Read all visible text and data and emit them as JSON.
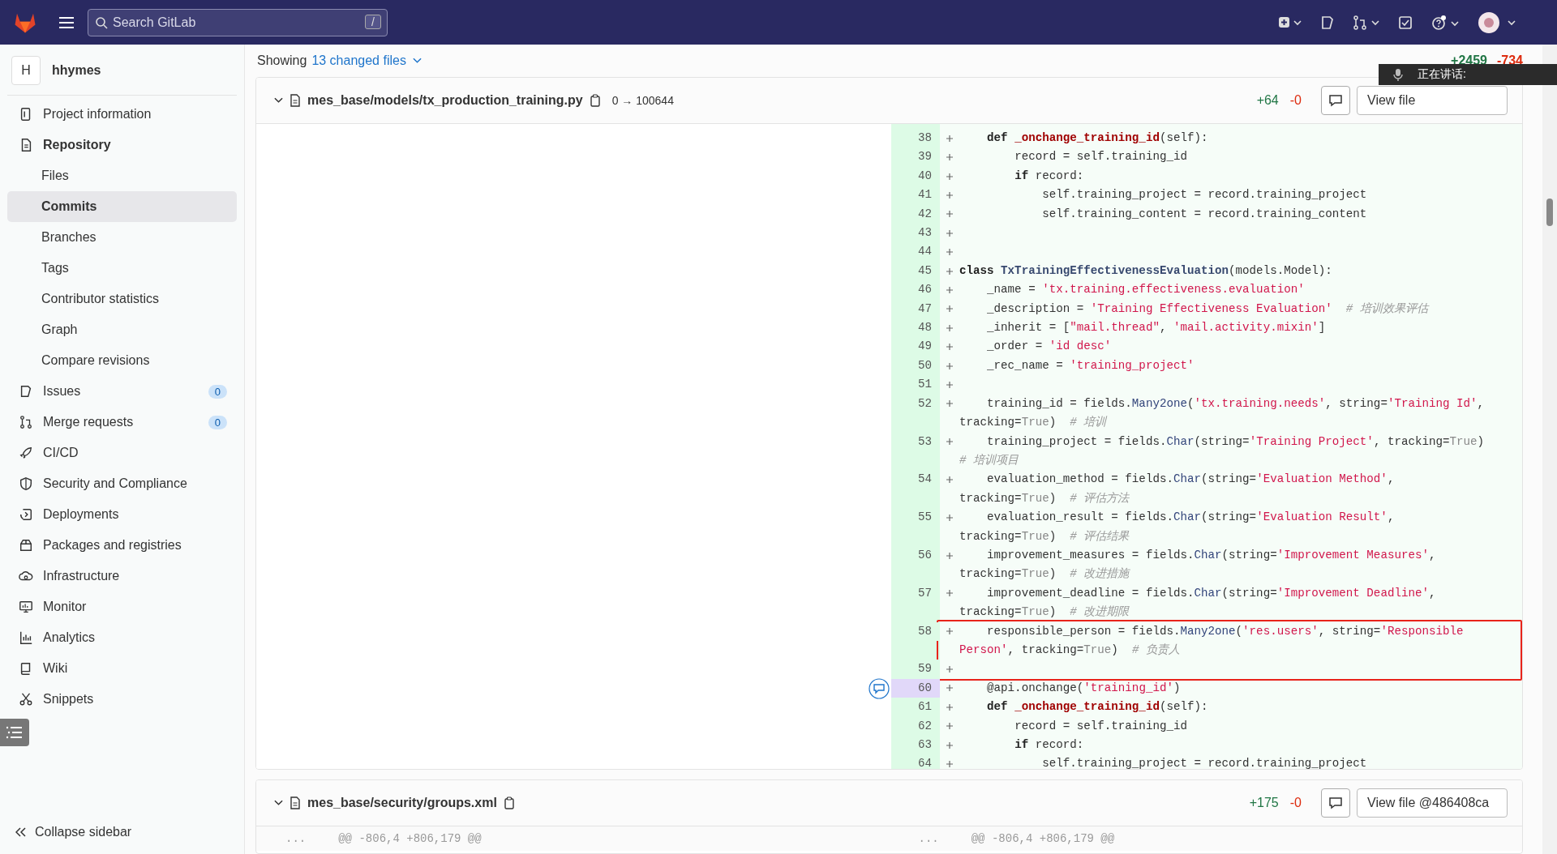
{
  "top_bar": {
    "search": {
      "placeholder": "Search GitLab",
      "shortcut": "/"
    }
  },
  "sidebar": {
    "project": {
      "avatar": "H",
      "name": "hhymes"
    },
    "items": [
      {
        "label": "Project information",
        "expanded": false
      },
      {
        "label": "Repository",
        "expanded": true,
        "children": [
          {
            "label": "Files",
            "selected": false
          },
          {
            "label": "Commits",
            "selected": true
          },
          {
            "label": "Branches",
            "selected": false
          },
          {
            "label": "Tags",
            "selected": false
          },
          {
            "label": "Contributor statistics",
            "selected": false
          },
          {
            "label": "Graph",
            "selected": false
          },
          {
            "label": "Compare revisions",
            "selected": false
          }
        ]
      },
      {
        "label": "Issues",
        "expanded": false,
        "badge": "0"
      },
      {
        "label": "Merge requests",
        "expanded": false,
        "badge": "0"
      },
      {
        "label": "CI/CD",
        "expanded": false
      },
      {
        "label": "Security and Compliance",
        "expanded": false
      },
      {
        "label": "Deployments",
        "expanded": false
      },
      {
        "label": "Packages and registries",
        "expanded": false
      },
      {
        "label": "Infrastructure",
        "expanded": false
      },
      {
        "label": "Monitor",
        "expanded": false
      },
      {
        "label": "Analytics",
        "expanded": false
      },
      {
        "label": "Wiki",
        "expanded": false
      },
      {
        "label": "Snippets",
        "expanded": false
      }
    ],
    "collapse": "Collapse sidebar"
  },
  "summary": {
    "prefix": "Showing",
    "link": "13 changed files",
    "added": "+2459",
    "removed": "-734"
  },
  "speaking_overlay": {
    "text": "正在讲话:"
  },
  "files": [
    {
      "path": "mes_base/models/tx_production_training.py",
      "mode": "0 → 100644",
      "added": "+64",
      "removed": "-0",
      "view_button": "View file",
      "lines": [
        {
          "num": "38",
          "highlighted": false,
          "boxed": false,
          "tokens": [
            {
              "kind": "kw",
              "text": "    def "
            },
            {
              "kind": "fn",
              "text": "_onchange_training_id"
            },
            {
              "kind": "plain",
              "text": "(self):"
            }
          ]
        },
        {
          "num": "39",
          "highlighted": false,
          "boxed": false,
          "tokens": [
            {
              "kind": "plain",
              "text": "        record = self.training_id"
            }
          ]
        },
        {
          "num": "40",
          "highlighted": false,
          "boxed": false,
          "tokens": [
            {
              "kind": "kw",
              "text": "        if"
            },
            {
              "kind": "plain",
              "text": " record:"
            }
          ]
        },
        {
          "num": "41",
          "highlighted": false,
          "boxed": false,
          "tokens": [
            {
              "kind": "plain",
              "text": "            self.training_project = record.training_project"
            }
          ]
        },
        {
          "num": "42",
          "highlighted": false,
          "boxed": false,
          "tokens": [
            {
              "kind": "plain",
              "text": "            self.training_content = record.training_content"
            }
          ]
        },
        {
          "num": "43",
          "highlighted": false,
          "boxed": false
        },
        {
          "num": "44",
          "highlighted": false,
          "boxed": false
        },
        {
          "num": "45",
          "highlighted": false,
          "boxed": false,
          "tokens": [
            {
              "kind": "kw",
              "text": "class "
            },
            {
              "kind": "cls",
              "text": "TxTrainingEffectivenessEvaluation"
            },
            {
              "kind": "plain",
              "text": "(models.Model):"
            }
          ]
        },
        {
          "num": "46",
          "highlighted": false,
          "boxed": false,
          "tokens": [
            {
              "kind": "plain",
              "text": "    _name = "
            },
            {
              "kind": "str",
              "text": "'tx.training.effectiveness.evaluation'"
            }
          ]
        },
        {
          "num": "47",
          "highlighted": false,
          "boxed": false,
          "tokens": [
            {
              "kind": "plain",
              "text": "    _description = "
            },
            {
              "kind": "str",
              "text": "'Training Effectiveness Evaluation'"
            },
            {
              "kind": "cmt",
              "text": "  # 培训效果评估"
            }
          ]
        },
        {
          "num": "48",
          "highlighted": false,
          "boxed": false,
          "tokens": [
            {
              "kind": "plain",
              "text": "    _inherit = ["
            },
            {
              "kind": "str",
              "text": "\"mail.thread\""
            },
            {
              "kind": "plain",
              "text": ", "
            },
            {
              "kind": "str",
              "text": "'mail.activity.mixin'"
            },
            {
              "kind": "plain",
              "text": "]"
            }
          ]
        },
        {
          "num": "49",
          "highlighted": false,
          "boxed": false,
          "tokens": [
            {
              "kind": "plain",
              "text": "    _order = "
            },
            {
              "kind": "str",
              "text": "'id desc'"
            }
          ]
        },
        {
          "num": "50",
          "highlighted": false,
          "boxed": false,
          "tokens": [
            {
              "kind": "plain",
              "text": "    _rec_name = "
            },
            {
              "kind": "str",
              "text": "'training_project'"
            }
          ]
        },
        {
          "num": "51",
          "highlighted": false,
          "boxed": false
        },
        {
          "num": "52",
          "highlighted": false,
          "boxed": false,
          "tokens": [
            {
              "kind": "plain",
              "text": "    training_id = fields."
            },
            {
              "kind": "call",
              "text": "Many2one"
            },
            {
              "kind": "plain",
              "text": "("
            },
            {
              "kind": "str",
              "text": "'tx.training.needs'"
            },
            {
              "kind": "plain",
              "text": ", string="
            },
            {
              "kind": "str",
              "text": "'Training Id'"
            },
            {
              "kind": "plain",
              "text": ", tracking="
            },
            {
              "kind": "lit",
              "text": "True"
            },
            {
              "kind": "plain",
              "text": ")  "
            },
            {
              "kind": "cmt",
              "text": "# 培训"
            }
          ]
        },
        {
          "num": "53",
          "highlighted": false,
          "boxed": false,
          "tokens": [
            {
              "kind": "plain",
              "text": "    training_project = fields."
            },
            {
              "kind": "call",
              "text": "Char"
            },
            {
              "kind": "plain",
              "text": "(string="
            },
            {
              "kind": "str",
              "text": "'Training Project'"
            },
            {
              "kind": "plain",
              "text": ", tracking="
            },
            {
              "kind": "lit",
              "text": "True"
            },
            {
              "kind": "plain",
              "text": ")  "
            },
            {
              "kind": "cmt",
              "text": "# 培训项目"
            }
          ]
        },
        {
          "num": "54",
          "highlighted": false,
          "boxed": false,
          "tokens": [
            {
              "kind": "plain",
              "text": "    evaluation_method = fields."
            },
            {
              "kind": "call",
              "text": "Char"
            },
            {
              "kind": "plain",
              "text": "(string="
            },
            {
              "kind": "str",
              "text": "'Evaluation Method'"
            },
            {
              "kind": "plain",
              "text": ", tracking="
            },
            {
              "kind": "lit",
              "text": "True"
            },
            {
              "kind": "plain",
              "text": ")  "
            },
            {
              "kind": "cmt",
              "text": "# 评估方法"
            }
          ]
        },
        {
          "num": "55",
          "highlighted": false,
          "boxed": false,
          "tokens": [
            {
              "kind": "plain",
              "text": "    evaluation_result = fields."
            },
            {
              "kind": "call",
              "text": "Char"
            },
            {
              "kind": "plain",
              "text": "(string="
            },
            {
              "kind": "str",
              "text": "'Evaluation Result'"
            },
            {
              "kind": "plain",
              "text": ", tracking="
            },
            {
              "kind": "lit",
              "text": "True"
            },
            {
              "kind": "plain",
              "text": ")  "
            },
            {
              "kind": "cmt",
              "text": "# 评估结果"
            }
          ]
        },
        {
          "num": "56",
          "highlighted": false,
          "boxed": false,
          "tokens": [
            {
              "kind": "plain",
              "text": "    improvement_measures = fields."
            },
            {
              "kind": "call",
              "text": "Char"
            },
            {
              "kind": "plain",
              "text": "(string="
            },
            {
              "kind": "str",
              "text": "'Improvement Measures'"
            },
            {
              "kind": "plain",
              "text": ", tracking="
            },
            {
              "kind": "lit",
              "text": "True"
            },
            {
              "kind": "plain",
              "text": ")  "
            },
            {
              "kind": "cmt",
              "text": "# 改进措施"
            }
          ]
        },
        {
          "num": "57",
          "highlighted": false,
          "boxed": false,
          "tokens": [
            {
              "kind": "plain",
              "text": "    improvement_deadline = fields."
            },
            {
              "kind": "call",
              "text": "Char"
            },
            {
              "kind": "plain",
              "text": "(string="
            },
            {
              "kind": "str",
              "text": "'Improvement Deadline'"
            },
            {
              "kind": "plain",
              "text": ", tracking="
            },
            {
              "kind": "lit",
              "text": "True"
            },
            {
              "kind": "plain",
              "text": ")  "
            },
            {
              "kind": "cmt",
              "text": "# 改进期限"
            }
          ]
        },
        {
          "num": "58",
          "highlighted": false,
          "boxed": true,
          "tokens": [
            {
              "kind": "plain",
              "text": "    responsible_person = fields."
            },
            {
              "kind": "call",
              "text": "Many2one"
            },
            {
              "kind": "plain",
              "text": "("
            },
            {
              "kind": "str",
              "text": "'res.users'"
            },
            {
              "kind": "plain",
              "text": ", string="
            },
            {
              "kind": "str",
              "text": "'Responsible Person'"
            },
            {
              "kind": "plain",
              "text": ", tracking="
            },
            {
              "kind": "lit",
              "text": "True"
            },
            {
              "kind": "plain",
              "text": ")  "
            },
            {
              "kind": "cmt",
              "text": "# 负责人"
            }
          ]
        },
        {
          "num": "59",
          "highlighted": false,
          "boxed": true
        },
        {
          "num": "60",
          "highlighted": true,
          "boxed": false,
          "tokens": [
            {
              "kind": "plain",
              "text": "    @api.onchange("
            },
            {
              "kind": "str",
              "text": "'training_id'"
            },
            {
              "kind": "plain",
              "text": ")"
            }
          ]
        },
        {
          "num": "61",
          "highlighted": false,
          "boxed": false,
          "tokens": [
            {
              "kind": "kw",
              "text": "    def "
            },
            {
              "kind": "fn",
              "text": "_onchange_training_id"
            },
            {
              "kind": "plain",
              "text": "(self):"
            }
          ]
        },
        {
          "num": "62",
          "highlighted": false,
          "boxed": false,
          "tokens": [
            {
              "kind": "plain",
              "text": "        record = self.training_id"
            }
          ]
        },
        {
          "num": "63",
          "highlighted": false,
          "boxed": false,
          "tokens": [
            {
              "kind": "kw",
              "text": "        if"
            },
            {
              "kind": "plain",
              "text": " record:"
            }
          ]
        },
        {
          "num": "64",
          "highlighted": false,
          "boxed": false,
          "tokens": [
            {
              "kind": "plain",
              "text": "            self.training_project = record.training_project"
            }
          ]
        }
      ]
    },
    {
      "path": "mes_base/security/groups.xml",
      "added": "+175",
      "removed": "-0",
      "view_button": "View file @486408ca",
      "hunk": {
        "old_marker": "...",
        "old_header": "@@ -806,4 +806,179 @@",
        "new_marker": "...",
        "new_header": "@@ -806,4 +806,179 @@"
      }
    }
  ]
}
